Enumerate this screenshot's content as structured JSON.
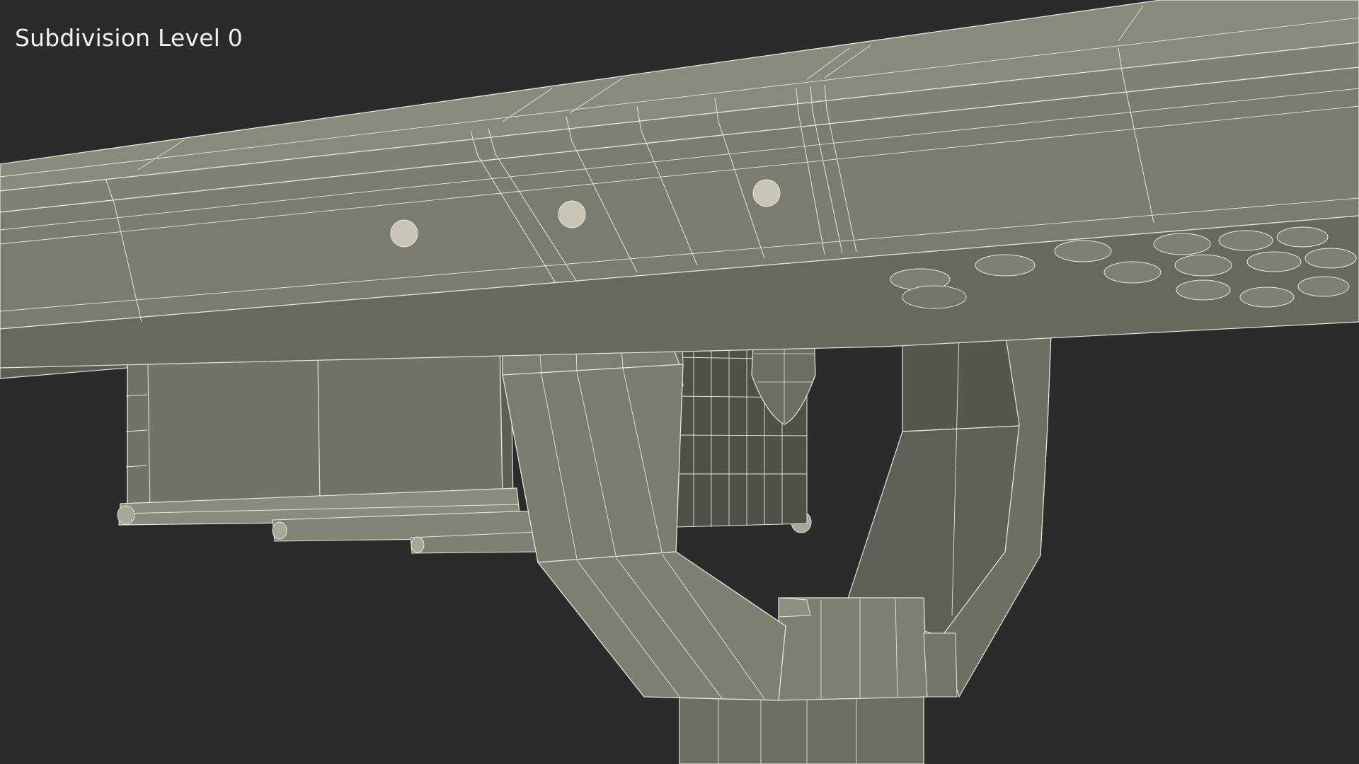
{
  "viewport": {
    "overlay_label": "Subdivision Level 0"
  },
  "scene": {
    "background_color": "#2b2b2b",
    "surface_color": "#7a7b6e",
    "shadow_color": "#585a50",
    "highlight_color": "#8e9082",
    "wire_color": "#e6e6dc"
  }
}
